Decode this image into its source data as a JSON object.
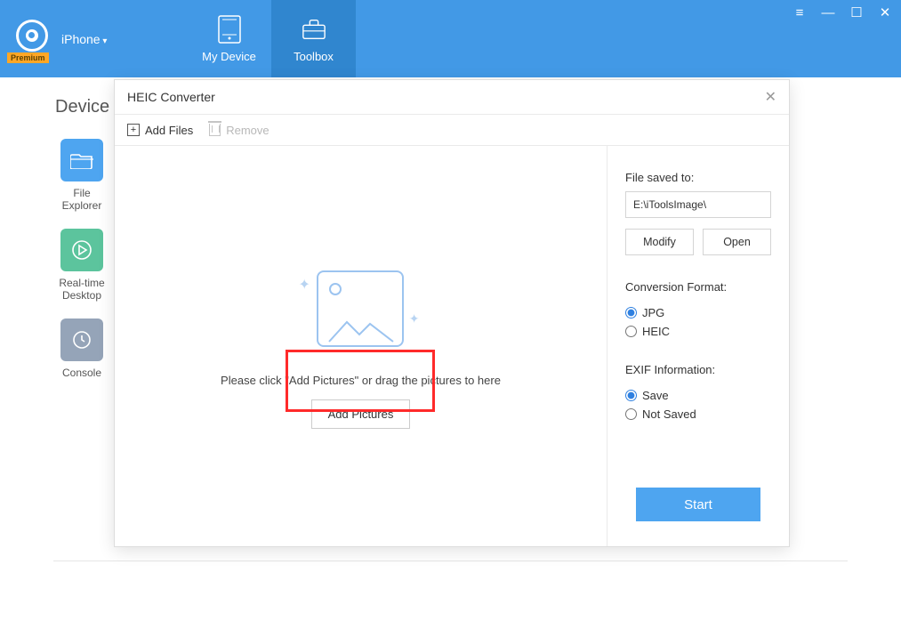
{
  "header": {
    "premium_badge": "Premium",
    "device_label": "iPhone",
    "tabs": {
      "my_device": "My Device",
      "toolbox": "Toolbox"
    }
  },
  "back": {
    "title": "Device",
    "items": {
      "file_explorer": "File\nExplorer",
      "realtime_desktop": "Real-time\nDesktop",
      "console": "Console"
    }
  },
  "modal": {
    "title": "HEIC Converter",
    "toolbar": {
      "add_files": "Add Files",
      "remove": "Remove"
    },
    "drop_hint": "Please click \"Add Pictures\" or drag the pictures to here",
    "add_pictures_btn": "Add Pictures",
    "side": {
      "saved_to_label": "File saved to:",
      "saved_to_path": "E:\\iToolsImage\\",
      "modify_btn": "Modify",
      "open_btn": "Open",
      "format_label": "Conversion Format:",
      "format_jpg": "JPG",
      "format_heic": "HEIC",
      "exif_label": "EXIF Information:",
      "exif_save": "Save",
      "exif_notsaved": "Not Saved",
      "start_btn": "Start"
    }
  }
}
